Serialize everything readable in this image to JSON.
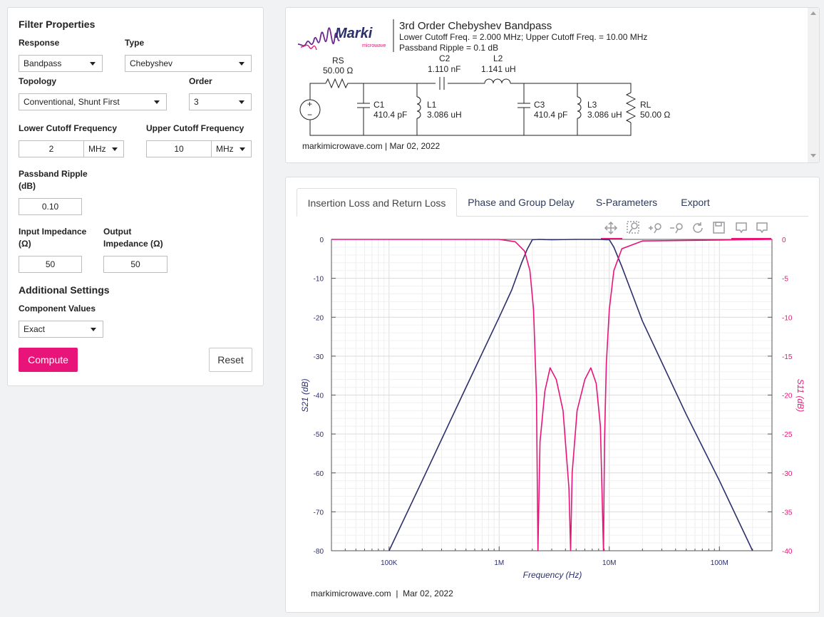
{
  "filter_properties": {
    "heading": "Filter Properties",
    "response": {
      "label": "Response",
      "value": "Bandpass"
    },
    "type": {
      "label": "Type",
      "value": "Chebyshev"
    },
    "topology": {
      "label": "Topology",
      "value": "Conventional, Shunt First"
    },
    "order": {
      "label": "Order",
      "value": "3"
    },
    "lower_cutoff": {
      "label": "Lower Cutoff Frequency",
      "value": "2",
      "unit": "MHz"
    },
    "upper_cutoff": {
      "label": "Upper Cutoff Frequency",
      "value": "10",
      "unit": "MHz"
    },
    "ripple": {
      "label_line1": "Passband Ripple",
      "label_line2": "(dB)",
      "value": "0.10"
    },
    "input_impedance": {
      "label_line1": "Input Impedance",
      "label_line2": "(Ω)",
      "value": "50"
    },
    "output_impedance": {
      "label_line1": "Output",
      "label_line2": "Impedance (Ω)",
      "value": "50"
    }
  },
  "additional_settings": {
    "heading": "Additional Settings",
    "component_values": {
      "label": "Component Values",
      "value": "Exact"
    }
  },
  "buttons": {
    "compute": "Compute",
    "reset": "Reset"
  },
  "schematic": {
    "logo_text": "Marki",
    "logo_sub": "microwave",
    "title": "3rd Order Chebyshev Bandpass",
    "line1": "Lower Cutoff Freq. = 2.000 MHz; Upper Cutoff Freq. = 10.00 MHz",
    "line2": "Passband Ripple = 0.1 dB",
    "footer": "markimicrowave.com | Mar 02, 2022",
    "components": {
      "rs_name": "RS",
      "rs_value": "50.00 Ω",
      "c2_name": "C2",
      "c2_value": "1.110 nF",
      "l2_name": "L2",
      "l2_value": "1.141 uH",
      "c1_name": "C1",
      "c1_value": "410.4 pF",
      "l1_name": "L1",
      "l1_value": "3.086 uH",
      "c3_name": "C3",
      "c3_value": "410.4 pF",
      "l3_name": "L3",
      "l3_value": "3.086 uH",
      "rl_name": "RL",
      "rl_value": "50.00 Ω",
      "src_plus": "+",
      "src_minus": "−"
    }
  },
  "tabs": [
    "Insertion Loss and Return Loss",
    "Phase and Group Delay",
    "S-Parameters",
    "Export"
  ],
  "chart_footer": "markimicrowave.com  |  Mar 02, 2022",
  "colors": {
    "accent": "#e8147a",
    "s21": "#2b2f6b",
    "s11": "#e8147a"
  },
  "chart_data": {
    "type": "line",
    "xlabel": "Frequency (Hz)",
    "ylabel": "S21 (dB)",
    "y2label": "S11 (dB)",
    "xscale": "log",
    "xlim": [
      30000,
      300000000
    ],
    "ylim": [
      -80,
      0
    ],
    "y2lim": [
      -40,
      0
    ],
    "x_ticks": [
      100000,
      1000000,
      10000000,
      100000000
    ],
    "x_tick_labels": [
      "100K",
      "1M",
      "10M",
      "100M"
    ],
    "y_ticks": [
      0,
      -10,
      -20,
      -30,
      -40,
      -50,
      -60,
      -70,
      -80
    ],
    "y2_ticks": [
      0,
      -5,
      -10,
      -15,
      -20,
      -25,
      -30,
      -35,
      -40
    ],
    "grid": true,
    "series": [
      {
        "name": "S21",
        "axis": "left",
        "x": [
          100000,
          200000,
          500000,
          1000000,
          1300000,
          1600000,
          1800000,
          2000000,
          2300000,
          3000000,
          5000000,
          8000000,
          9500000,
          10000000,
          11000000,
          13000000,
          20000000,
          50000000,
          100000000,
          200000000
        ],
        "y": [
          -80,
          -62,
          -38,
          -20,
          -13,
          -6,
          -2.5,
          -0.1,
          0,
          -0.1,
          0,
          0,
          -0.1,
          -0.1,
          -2,
          -7,
          -21,
          -45,
          -62,
          -80
        ]
      },
      {
        "name": "S11",
        "axis": "right",
        "x": [
          30000,
          1000000,
          1400000,
          1700000,
          1900000,
          2050000,
          2180000,
          2250000,
          2350000,
          2600000,
          2900000,
          3300000,
          3800000,
          4300000,
          4450000,
          4600000,
          5100000,
          6000000,
          6800000,
          7600000,
          8300000,
          8850000,
          9050000,
          9400000,
          10000000,
          11000000,
          13000000,
          20000000,
          300000000
        ],
        "y": [
          0,
          0,
          -0.3,
          -1.5,
          -4,
          -9,
          -20,
          -40,
          -26,
          -19.5,
          -16.5,
          -18,
          -22,
          -32,
          -40,
          -30,
          -22,
          -18,
          -16.5,
          -18.5,
          -24,
          -40,
          -26,
          -16,
          -9,
          -4,
          -1.2,
          -0.2,
          0
        ]
      }
    ]
  }
}
